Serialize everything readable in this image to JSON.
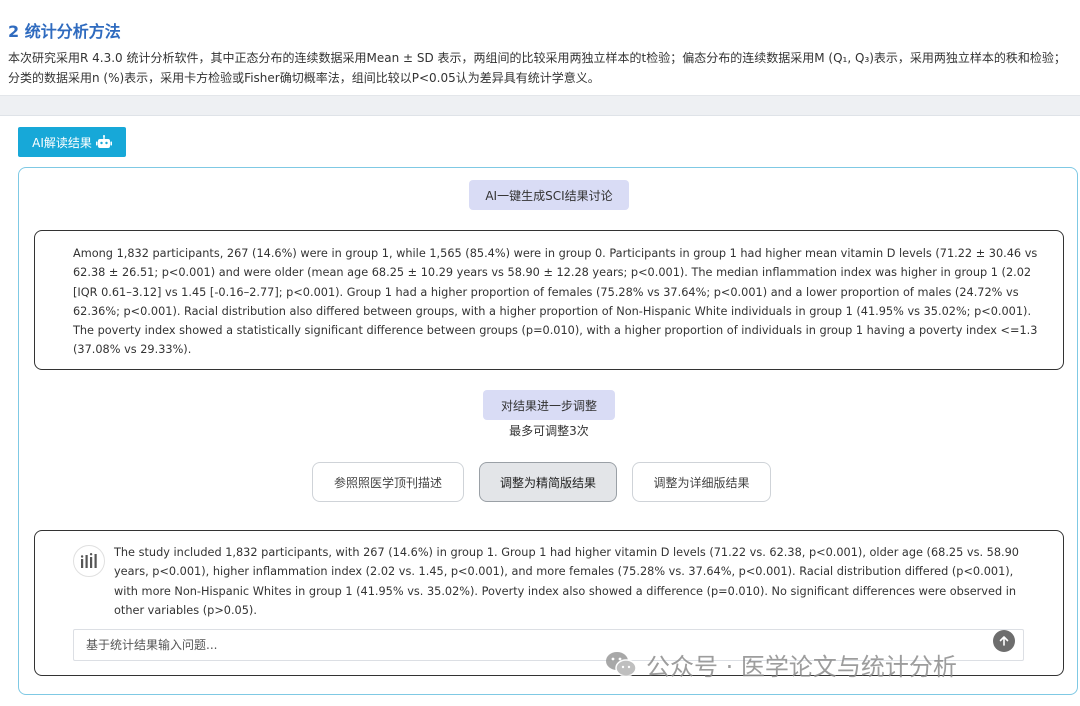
{
  "section": {
    "title": "2 统计分析方法",
    "method_text": "本次研究采用R 4.3.0 统计分析软件，其中正态分布的连续数据采用Mean ± SD 表示，两组间的比较采用两独立样本的t检验；偏态分布的连续数据采用M (Q₁, Q₃)表示，采用两独立样本的秩和检验；分类的数据采用n (%)表示，采用卡方检验或Fisher确切概率法，组间比较以P<0.05认为差异具有统计学意义。"
  },
  "ai_button": {
    "label": "AI解读结果",
    "icon": "robot-icon"
  },
  "generate_button": {
    "label": "AI一键生成SCI结果讨论"
  },
  "result_text": "Among 1,832 participants, 267 (14.6%) were in group 1, while 1,565 (85.4%) were in group 0. Participants in group 1 had higher mean vitamin D levels (71.22 ± 30.46 vs 62.38 ± 26.51; p<0.001) and were older (mean age 68.25 ± 10.29 years vs 58.90 ± 12.28 years; p<0.001). The median inflammation index was higher in group 1 (2.02 [IQR 0.61–3.12] vs 1.45 [-0.16–2.77]; p<0.001). Group 1 had a higher proportion of females (75.28% vs 37.64%; p<0.001) and a lower proportion of males (24.72% vs 62.36%; p<0.001). Racial distribution also differed between groups, with a higher proportion of Non-Hispanic White individuals in group 1 (41.95% vs 35.02%; p<0.001). The poverty index showed a statistically significant difference between groups (p=0.010), with a higher proportion of individuals in group 1 having a poverty index <=1.3 (37.08% vs 29.33%).",
  "adjust": {
    "button_label": "对结果进一步调整",
    "note": "最多可调整3次"
  },
  "options": [
    {
      "label": "参照照医学顶刊描述"
    },
    {
      "label": "调整为精简版结果"
    },
    {
      "label": "调整为详细版结果"
    }
  ],
  "chat": {
    "avatar_icon": "bot-avatar-icon",
    "reply": "The study included 1,832 participants, with 267 (14.6%) in group 1. Group 1 had higher vitamin D levels (71.22 vs. 62.38, p<0.001), older age (68.25 vs. 58.90 years, p<0.001), higher inflammation index (2.02 vs. 1.45, p<0.001), and more females (75.28% vs. 37.64%, p<0.001). Racial distribution differed (p<0.001), with more Non-Hispanic Whites in group 1 (41.95% vs. 35.02%). Poverty index also showed a difference (p=0.010). No significant differences were observed in other variables (p>0.05).",
    "input_placeholder": "基于统计结果输入问题...",
    "input_value": ""
  },
  "watermark": {
    "text": "公众号 · 医学论文与统计分析"
  },
  "colors": {
    "title": "#2f6bbf",
    "ai_button": "#17a8d8",
    "panel_border": "#7fc9e4",
    "pill_bg": "#d9dcf5"
  }
}
